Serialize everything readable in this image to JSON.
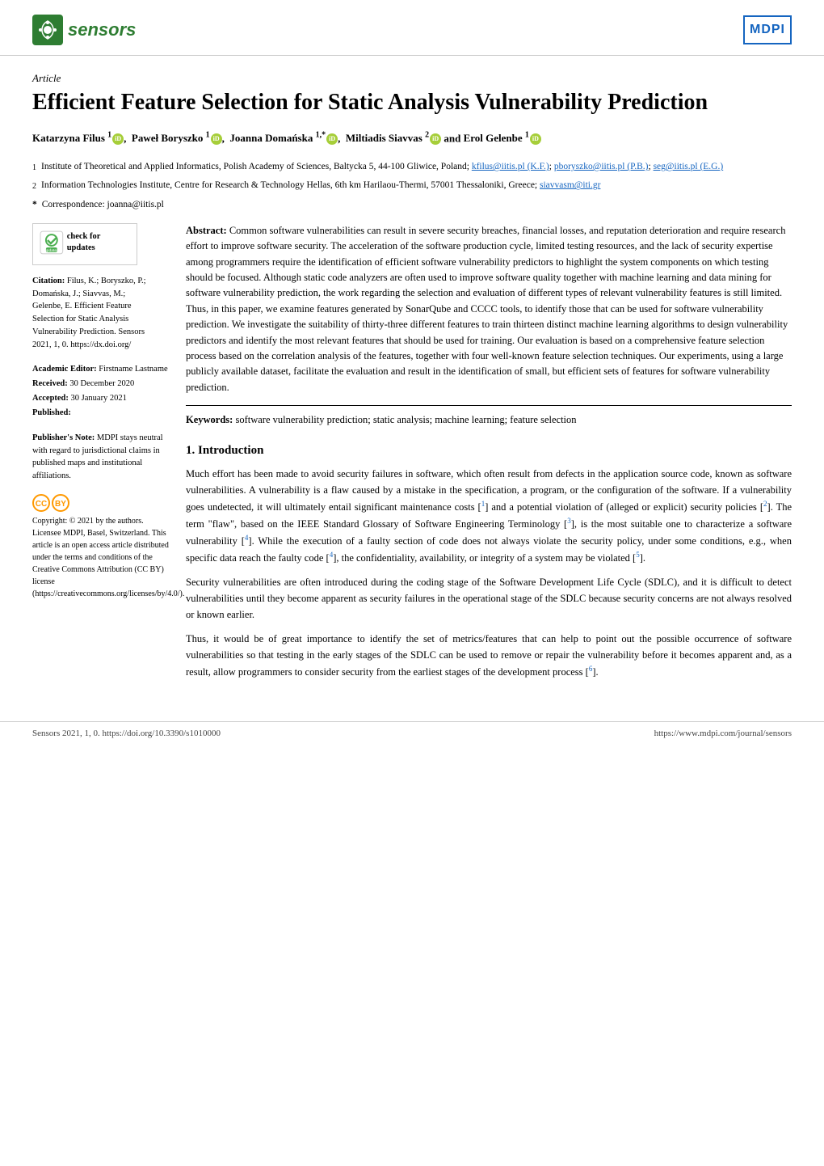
{
  "header": {
    "journal_name": "sensors",
    "mdpi_label": "MDPI"
  },
  "article": {
    "type": "Article",
    "title": "Efficient Feature Selection for Static Analysis Vulnerability Prediction",
    "authors": [
      {
        "name": "Katarzyna Filus",
        "sup": "1",
        "orcid": true
      },
      {
        "name": "Paweł Boryszko",
        "sup": "1",
        "orcid": true
      },
      {
        "name": "Joanna Domańska",
        "sup": "1,*",
        "orcid": true
      },
      {
        "name": "Miltiadis Siavvas",
        "sup": "2",
        "orcid": true
      },
      {
        "name": "Erol Gelenbe",
        "sup": "1",
        "orcid": true
      }
    ],
    "affiliations": [
      {
        "num": "1",
        "text": "Institute of Theoretical and Applied Informatics, Polish Academy of Sciences, Baltycka 5, 44-100 Gliwice, Poland;",
        "emails": [
          "kfilus@iitis.pl (K.F.)",
          "pboryszko@iitis.pl (P.B.)",
          "seg@iitis.pl (E.G.)"
        ]
      },
      {
        "num": "2",
        "text": "Information Technologies Institute, Centre for Research & Technology Hellas, 6th km Harilaou-Thermi, 57001 Thessaloniki, Greece;",
        "emails": [
          "siavvasm@iti.gr"
        ]
      }
    ],
    "correspondence": "* Correspondence: joanna@iitis.pl",
    "abstract_label": "Abstract:",
    "abstract": "Common software vulnerabilities can result in severe security breaches, financial losses, and reputation deterioration and require research effort to improve software security. The acceleration of the software production cycle, limited testing resources, and the lack of security expertise among programmers require the identification of efficient software vulnerability predictors to highlight the system components on which testing should be focused. Although static code analyzers are often used to improve software quality together with machine learning and data mining for software vulnerability prediction, the work regarding the selection and evaluation of different types of relevant vulnerability features is still limited. Thus, in this paper, we examine features generated by SonarQube and CCCC tools, to identify those that can be used for software vulnerability prediction. We investigate the suitability of thirty-three different features to train thirteen distinct machine learning algorithms to design vulnerability predictors and identify the most relevant features that should be used for training. Our evaluation is based on a comprehensive feature selection process based on the correlation analysis of the features, together with four well-known feature selection techniques. Our experiments, using a large publicly available dataset, facilitate the evaluation and result in the identification of small, but efficient sets of features for software vulnerability prediction.",
    "keywords_label": "Keywords:",
    "keywords": "software vulnerability prediction; static analysis; machine learning; feature selection",
    "section1_title": "1. Introduction",
    "section1_p1": "Much effort has been made to avoid security failures in software, which often result from defects in the application source code, known as software vulnerabilities. A vulnerability is a flaw caused by a mistake in the specification, a program, or the configuration of the software. If a vulnerability goes undetected, it will ultimately entail significant maintenance costs [1] and a potential violation of (alleged or explicit) security policies [2]. The term \"flaw\", based on the IEEE Standard Glossary of Software Engineering Terminology [3], is the most suitable one to characterize a software vulnerability [4]. While the execution of a faulty section of code does not always violate the security policy, under some conditions, e.g., when specific data reach the faulty code [4], the confidentiality, availability, or integrity of a system may be violated [5].",
    "section1_p2": "Security vulnerabilities are often introduced during the coding stage of the Software Development Life Cycle (SDLC), and it is difficult to detect vulnerabilities until they become apparent as security failures in the operational stage of the SDLC because security concerns are not always resolved or known earlier.",
    "section1_p3": "Thus, it would be of great importance to identify the set of metrics/features that can help to point out the possible occurrence of software vulnerabilities so that testing in the early stages of the SDLC can be used to remove or repair the vulnerability before it becomes apparent and, as a result, allow programmers to consider security from the earliest stages of the development process [6]."
  },
  "sidebar": {
    "check_updates_text": "check for updates",
    "citation_label": "Citation:",
    "citation_text": "Filus, K.; Boryszko, P.; Domańska, J.; Siavvas, M.; Gelenbe, E. Efficient Feature Selection for Static Analysis Vulnerability Prediction. Sensors 2021, 1, 0. https://dx.doi.org/",
    "academic_editor_label": "Academic Editor:",
    "academic_editor": "Firstname Lastname",
    "received_label": "Received:",
    "received": "30 December 2020",
    "accepted_label": "Accepted:",
    "accepted": "30 January 2021",
    "published_label": "Published:",
    "published": "",
    "publisher_note_label": "Publisher's Note:",
    "publisher_note": "MDPI stays neutral with regard to jurisdictional claims in published maps and institutional affiliations.",
    "copyright_text": "Copyright: © 2021 by the authors. Licensee MDPI, Basel, Switzerland. This article is an open access article distributed under the terms and conditions of the Creative Commons Attribution (CC BY) license (https://creativecommons.org/licenses/by/4.0/)."
  },
  "footer": {
    "left": "Sensors 2021, 1, 0. https://doi.org/10.3390/s1010000",
    "right": "https://www.mdpi.com/journal/sensors"
  }
}
